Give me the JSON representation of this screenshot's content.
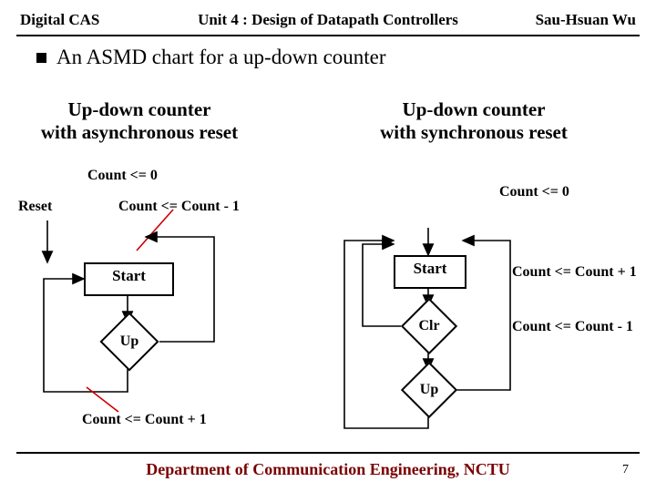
{
  "header": {
    "left": "Digital CAS",
    "center": "Unit 4 : Design of Datapath Controllers",
    "right": "Sau-Hsuan Wu"
  },
  "bullet": "An ASMD chart for a up-down counter",
  "subtitles": {
    "left": "Up-down counter\nwith asynchronous reset",
    "right": "Up-down counter\nwith synchronous reset"
  },
  "labels": {
    "countZeroL": "Count <= 0",
    "countZeroR": "Count <= 0",
    "reset": "Reset",
    "countMinus1L": "Count <= Count - 1",
    "countPlus1L": "Count <= Count + 1",
    "countPlus1R": "Count <= Count + 1",
    "countMinus1R": "Count <= Count - 1"
  },
  "boxes": {
    "startL": "Start",
    "startR": "Start",
    "upL": "Up",
    "clrR": "Clr",
    "upR": "Up"
  },
  "footer": {
    "dept": "Department of Communication Engineering, NCTU",
    "page": "7"
  }
}
